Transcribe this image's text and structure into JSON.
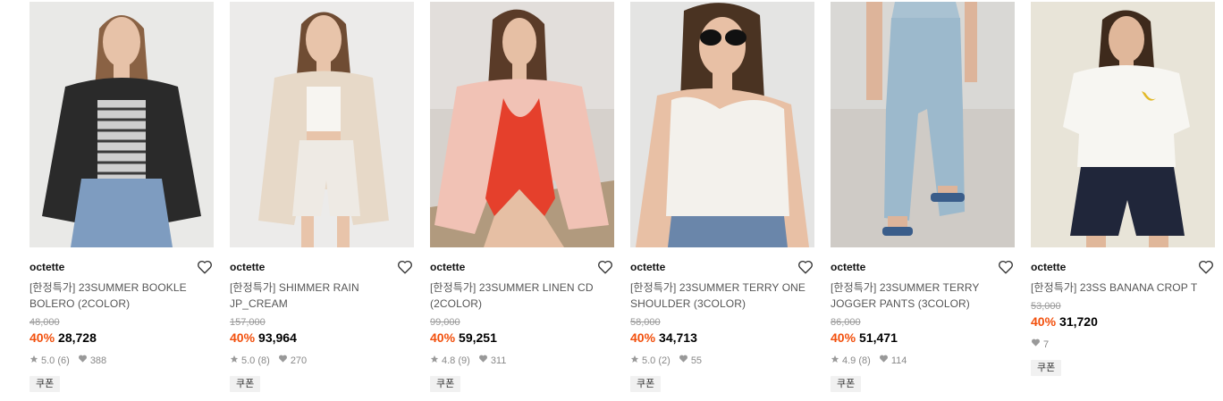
{
  "products": [
    {
      "brand": "octette",
      "name": "[한정특가] 23SUMMER BOOKLE BOLERO (2COLOR)",
      "original_price": "48,000",
      "discount": "40%",
      "price": "28,728",
      "rating": "5.0",
      "reviews": "(6)",
      "likes": "388",
      "coupon": "쿠폰",
      "photo": {
        "bg": "#e9e9e7",
        "top": "#2a2a2a",
        "bottom": "#7e9cc0",
        "skin": "#e7c2a8",
        "hair": "#8a6244"
      }
    },
    {
      "brand": "octette",
      "name": "[한정특가] SHIMMER RAIN JP_CREAM",
      "original_price": "157,000",
      "discount": "40%",
      "price": "93,964",
      "rating": "5.0",
      "reviews": "(8)",
      "likes": "270",
      "coupon": "쿠폰",
      "photo": {
        "bg": "#ecebea",
        "top": "#e7d9c8",
        "bottom": "#eeeae4",
        "skin": "#e8c4aa",
        "hair": "#6f4c33"
      }
    },
    {
      "brand": "octette",
      "name": "[한정특가] 23SUMMER LINEN CD (2COLOR)",
      "original_price": "99,000",
      "discount": "40%",
      "price": "59,251",
      "rating": "4.8",
      "reviews": "(9)",
      "likes": "311",
      "coupon": "쿠폰",
      "photo": {
        "bg": "#d6d1cc",
        "top": "#f1c2b5",
        "bottom": "#e5402c",
        "skin": "#e6bfa4",
        "hair": "#5a3b28"
      }
    },
    {
      "brand": "octette",
      "name": "[한정특가] 23SUMMER TERRY ONE SHOULDER (3COLOR)",
      "original_price": "58,000",
      "discount": "40%",
      "price": "34,713",
      "rating": "5.0",
      "reviews": "(2)",
      "likes": "55",
      "coupon": "쿠폰",
      "photo": {
        "bg": "#e4e4e3",
        "top": "#f3f1ec",
        "bottom": "#6a86aa",
        "skin": "#e8c0a5",
        "hair": "#4a3322"
      }
    },
    {
      "brand": "octette",
      "name": "[한정특가] 23SUMMER TERRY JOGGER PANTS (3COLOR)",
      "original_price": "86,000",
      "discount": "40%",
      "price": "51,471",
      "rating": "4.9",
      "reviews": "(8)",
      "likes": "114",
      "coupon": "쿠폰",
      "photo": {
        "bg": "#d9d8d5",
        "top": "#a9c2d2",
        "bottom": "#9cb9cc",
        "skin": "#ddb49a",
        "hair": "#3a5d8a"
      }
    },
    {
      "brand": "octette",
      "name": "[한정특가] 23SS BANANA CROP T",
      "original_price": "53,000",
      "discount": "40%",
      "price": "31,720",
      "rating": "",
      "reviews": "",
      "likes": "7",
      "coupon": "쿠폰",
      "photo": {
        "bg": "#e8e4d8",
        "top": "#f7f6f2",
        "bottom": "#20263a",
        "skin": "#e0b79a",
        "hair": "#3e2a1c"
      }
    }
  ]
}
